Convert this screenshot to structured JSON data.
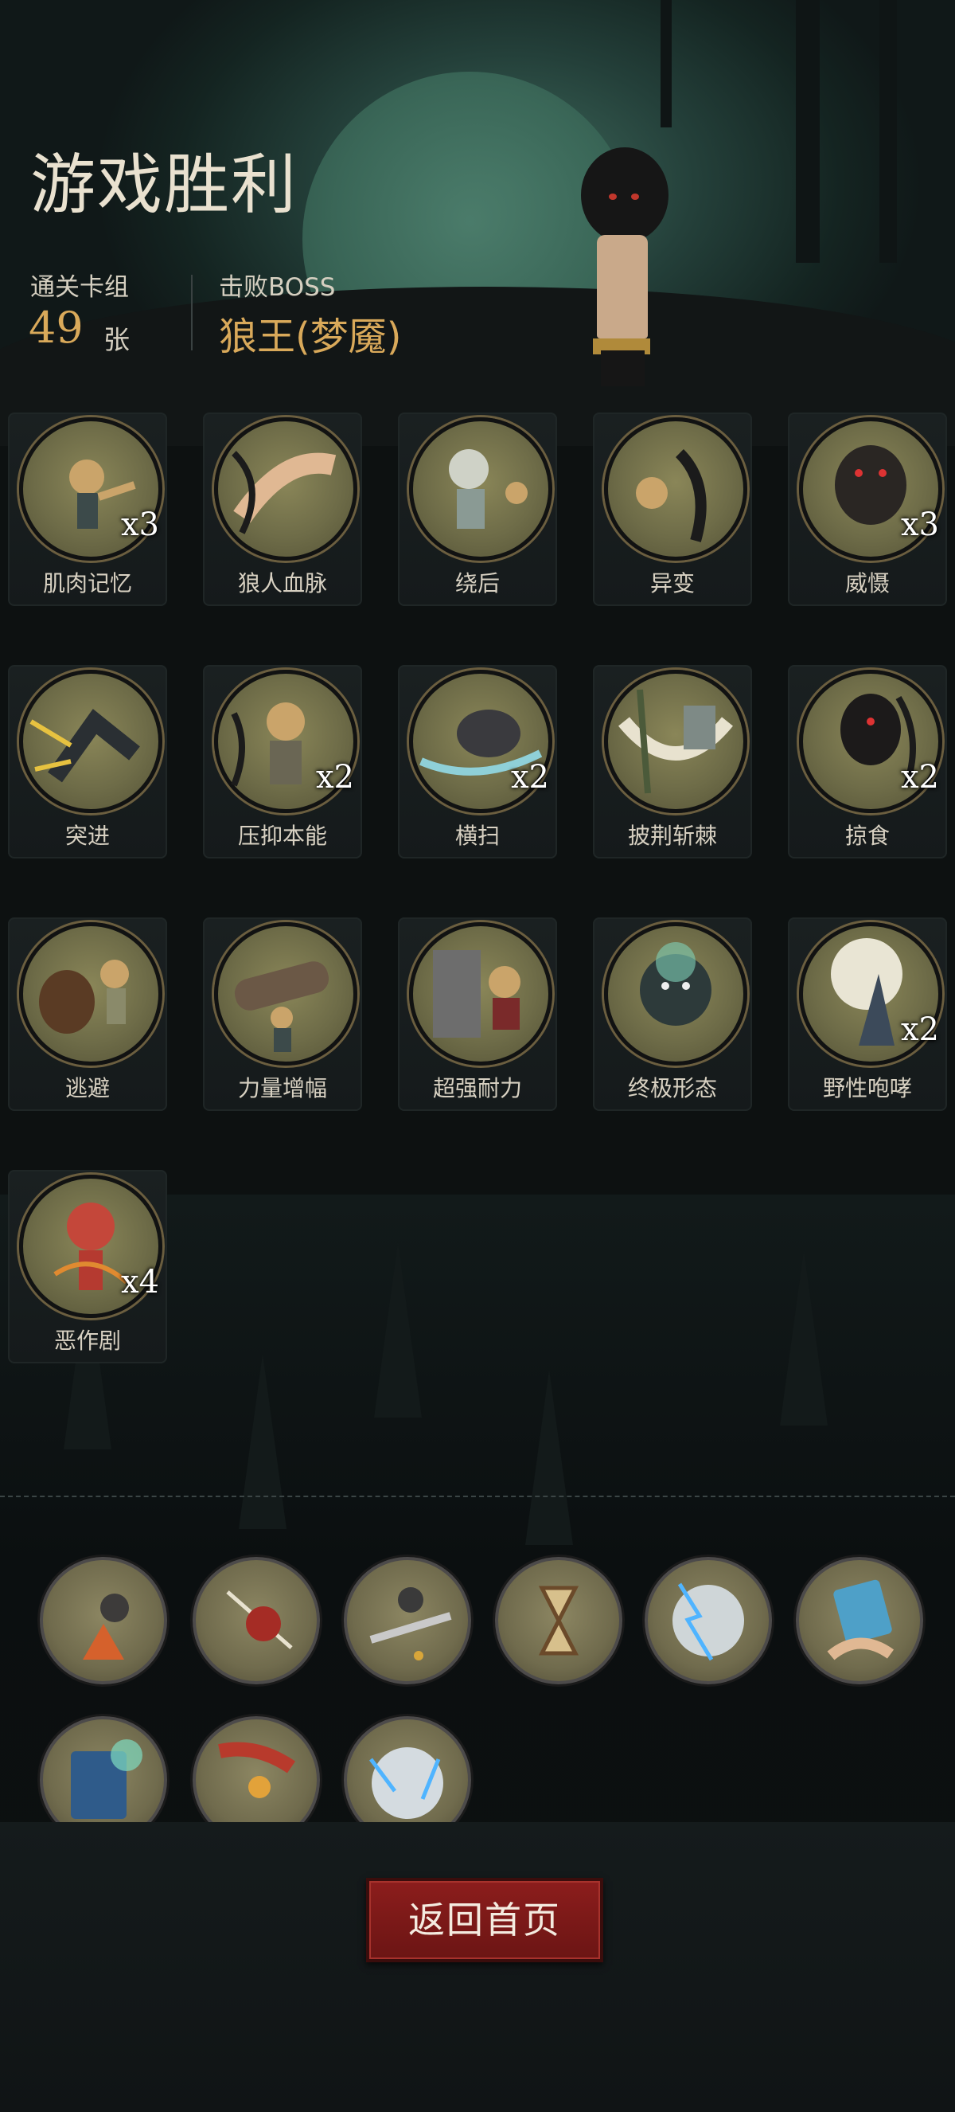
{
  "header": {
    "title": "游戏胜利",
    "deck_label": "通关卡组",
    "deck_count": "49",
    "deck_unit": "张",
    "boss_label": "击败BOSS",
    "boss_name": "狼王(梦魇)"
  },
  "cards": [
    {
      "name": "肌肉记忆",
      "qty": "x3",
      "icon": "muscle-boy-icon"
    },
    {
      "name": "狼人血脉",
      "qty": "",
      "icon": "wolf-arm-icon"
    },
    {
      "name": "绕后",
      "qty": "",
      "icon": "skeleton-icon"
    },
    {
      "name": "异变",
      "qty": "",
      "icon": "mutation-icon"
    },
    {
      "name": "威慑",
      "qty": "x3",
      "icon": "werewolf-icon"
    },
    {
      "name": "突进",
      "qty": "",
      "icon": "wolf-dash-icon"
    },
    {
      "name": "压抑本能",
      "qty": "x2",
      "icon": "suppress-icon"
    },
    {
      "name": "横扫",
      "qty": "x2",
      "icon": "sweep-icon"
    },
    {
      "name": "披荆斩棘",
      "qty": "",
      "icon": "axe-thorns-icon"
    },
    {
      "name": "掠食",
      "qty": "x2",
      "icon": "predator-icon"
    },
    {
      "name": "逃避",
      "qty": "",
      "icon": "bear-escape-icon"
    },
    {
      "name": "力量增幅",
      "qty": "",
      "icon": "log-lift-icon"
    },
    {
      "name": "超强耐力",
      "qty": "",
      "icon": "endurance-icon"
    },
    {
      "name": "终极形态",
      "qty": "",
      "icon": "ultimate-wolf-icon"
    },
    {
      "name": "野性咆哮",
      "qty": "x2",
      "icon": "howl-icon"
    },
    {
      "name": "恶作剧",
      "qty": "x4",
      "icon": "scarecrow-icon"
    }
  ],
  "relics": [
    {
      "icon": "campfire-icon"
    },
    {
      "icon": "red-hood-icon"
    },
    {
      "icon": "falling-sword-icon"
    },
    {
      "icon": "hourglass-icon"
    },
    {
      "icon": "lightning-clock-icon"
    },
    {
      "icon": "magic-hand-icon"
    },
    {
      "icon": "spellbook-icon"
    },
    {
      "icon": "caped-hero-icon"
    },
    {
      "icon": "stopwatch-lightning-icon"
    }
  ],
  "actions": {
    "return_label": "返回首页"
  }
}
